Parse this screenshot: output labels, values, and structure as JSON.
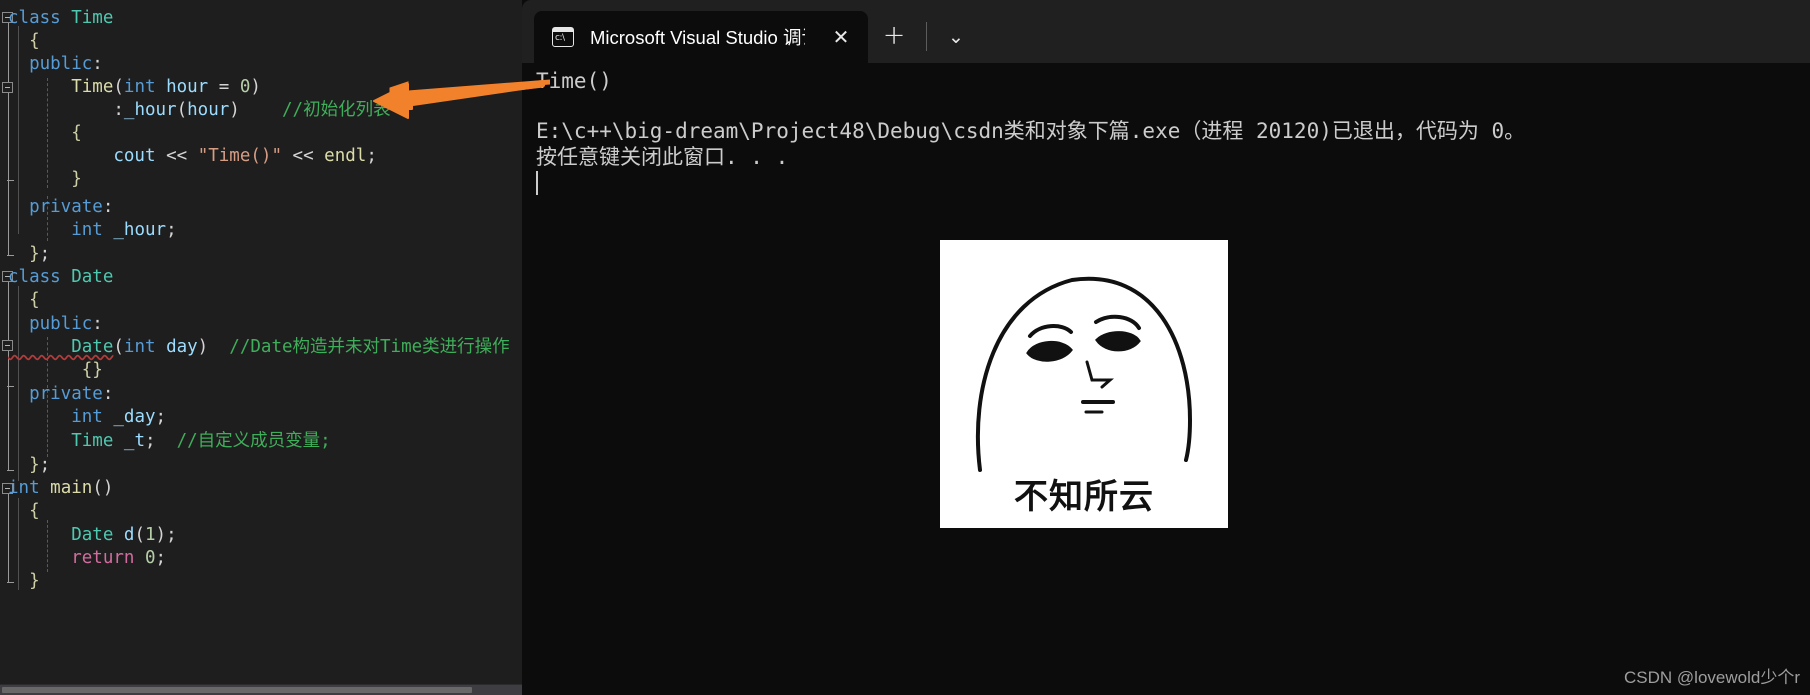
{
  "editor": {
    "name": "visual-studio-code-editor",
    "lines": [
      {
        "id": "l1",
        "text": "class Time"
      },
      {
        "id": "l2",
        "text": " {"
      },
      {
        "id": "l3",
        "text": " public:"
      },
      {
        "id": "l4",
        "text": "     Time(int hour = 0)"
      },
      {
        "id": "l5",
        "text": "         :_hour(hour)    //初始化列表"
      },
      {
        "id": "l6",
        "text": "     {"
      },
      {
        "id": "l7",
        "text": "         cout << \"Time()\" << endl;"
      },
      {
        "id": "l8",
        "text": "     }"
      },
      {
        "id": "l9",
        "text": " private:"
      },
      {
        "id": "l10",
        "text": "     int _hour;"
      },
      {
        "id": "l11",
        "text": " };"
      },
      {
        "id": "l12",
        "text": "class Date"
      },
      {
        "id": "l13",
        "text": " {"
      },
      {
        "id": "l14",
        "text": " public:"
      },
      {
        "id": "l15",
        "text": "     Date(int day)  //Date构造并未对Time类进行操作"
      },
      {
        "id": "l16",
        "text": "      {}"
      },
      {
        "id": "l17",
        "text": " private:"
      },
      {
        "id": "l18",
        "text": "     int _day;"
      },
      {
        "id": "l19",
        "text": "     Time _t;  //自定义成员变量;"
      },
      {
        "id": "l20",
        "text": " };"
      },
      {
        "id": "l21",
        "text": "int main()"
      },
      {
        "id": "l22",
        "text": " {"
      },
      {
        "id": "l23",
        "text": "     Date d(1);"
      },
      {
        "id": "l24",
        "text": "     return 0;"
      },
      {
        "id": "l25",
        "text": " }"
      }
    ],
    "comments": {
      "init_list": "//初始化列表",
      "date_ctor": "//Date构造并未对Time类进行操作",
      "member_var": "//自定义成员变量;"
    },
    "colors": {
      "background": "#1e1e1e",
      "keyword": "#569cd6",
      "type": "#4ec9b0",
      "function": "#dcdcaa",
      "variable": "#9cdcfe",
      "string": "#d69d85",
      "number": "#b5cea8",
      "comment": "#3fae5a",
      "control": "#d16d9e",
      "plain": "#d4d4d4"
    }
  },
  "annotation": {
    "arrow_color": "#f2812c",
    "arrow_label": "arrow-pointing-to-initializer-list-comment"
  },
  "terminal": {
    "tab_title": "Microsoft Visual Studio 调试控",
    "tab_icon": "console-cs-icon",
    "close_label": "✕",
    "new_tab_label": "+",
    "dropdown_label": "⌄",
    "background": "#0c0c0c",
    "titlebar_background": "#202020",
    "output": {
      "program_output": "Time()",
      "exit_message": "E:\\c++\\big-dream\\Project48\\Debug\\csdn类和对象下篇.exe（进程 20120)已退出，代码为 0。",
      "press_key_message": "按任意键关闭此窗口. . ."
    }
  },
  "meme": {
    "caption": "不知所云",
    "alt": "confused-face-meme"
  },
  "watermark": {
    "text": "CSDN @lovewold少个r"
  }
}
